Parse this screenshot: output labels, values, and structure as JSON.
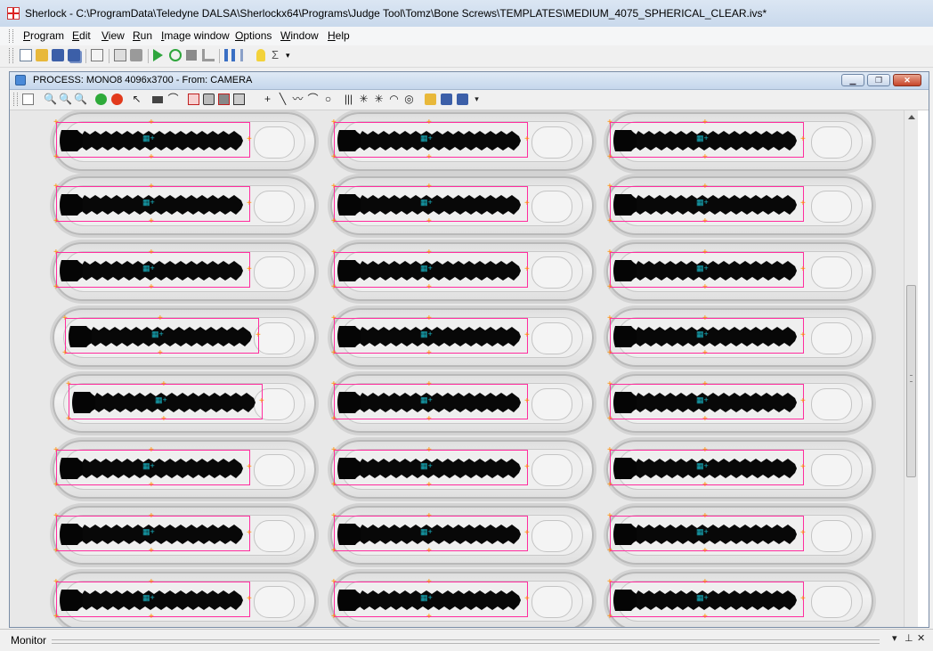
{
  "window": {
    "title": "Sherlock - C:\\ProgramData\\Teledyne DALSA\\Sherlockx64\\Programs\\Judge Tool\\Tomz\\Bone Screws\\TEMPLATES\\MEDIUM_4075_SPHERICAL_CLEAR.ivs*"
  },
  "menu": {
    "items": [
      "Program",
      "Edit",
      "View",
      "Run",
      "Image window",
      "Options",
      "Window",
      "Help"
    ]
  },
  "toolbar": {
    "icons": [
      "new-icon",
      "open-icon",
      "save-icon",
      "save-as-icon",
      "print-icon",
      "copy-icon",
      "paste-icon",
      "run-icon",
      "run-continuous-icon",
      "stop-icon",
      "step-icon",
      "pause-icon",
      "resume-icon",
      "lightbulb-icon",
      "sigma-icon"
    ]
  },
  "child_window": {
    "title": "PROCESS: MONO8 4096x3700 - From: CAMERA",
    "buttons": {
      "minimize": "▁",
      "restore": "❐",
      "close": "✕"
    }
  },
  "image_toolbar": {
    "icons": [
      "properties-icon",
      "zoom-out-icon",
      "zoom-in-icon",
      "zoom-fit-icon",
      "green-light-icon",
      "red-light-icon",
      "pointer-icon",
      "rectangle-roi-icon",
      "arc-roi-icon",
      "rect-select-icon",
      "circle-select-icon",
      "polygon-select-icon",
      "annulus-select-icon",
      "point-roi-icon",
      "line-roi-icon",
      "polyline-roi-icon",
      "arc-icon",
      "circle-icon",
      "rake-icon",
      "spoke-icon",
      "spoke-alt-icon",
      "bullseye-icon",
      "target-icon",
      "load-image-icon",
      "save-image-icon",
      "save-all-icon"
    ]
  },
  "image": {
    "description_colors": {
      "roi": "#ff2d9e",
      "marker": "#ff8c00",
      "center": "#18b8c8"
    }
  },
  "monitor": {
    "label": "Monitor",
    "dropdown": "▾",
    "pin": "⊥",
    "close": "✕"
  }
}
